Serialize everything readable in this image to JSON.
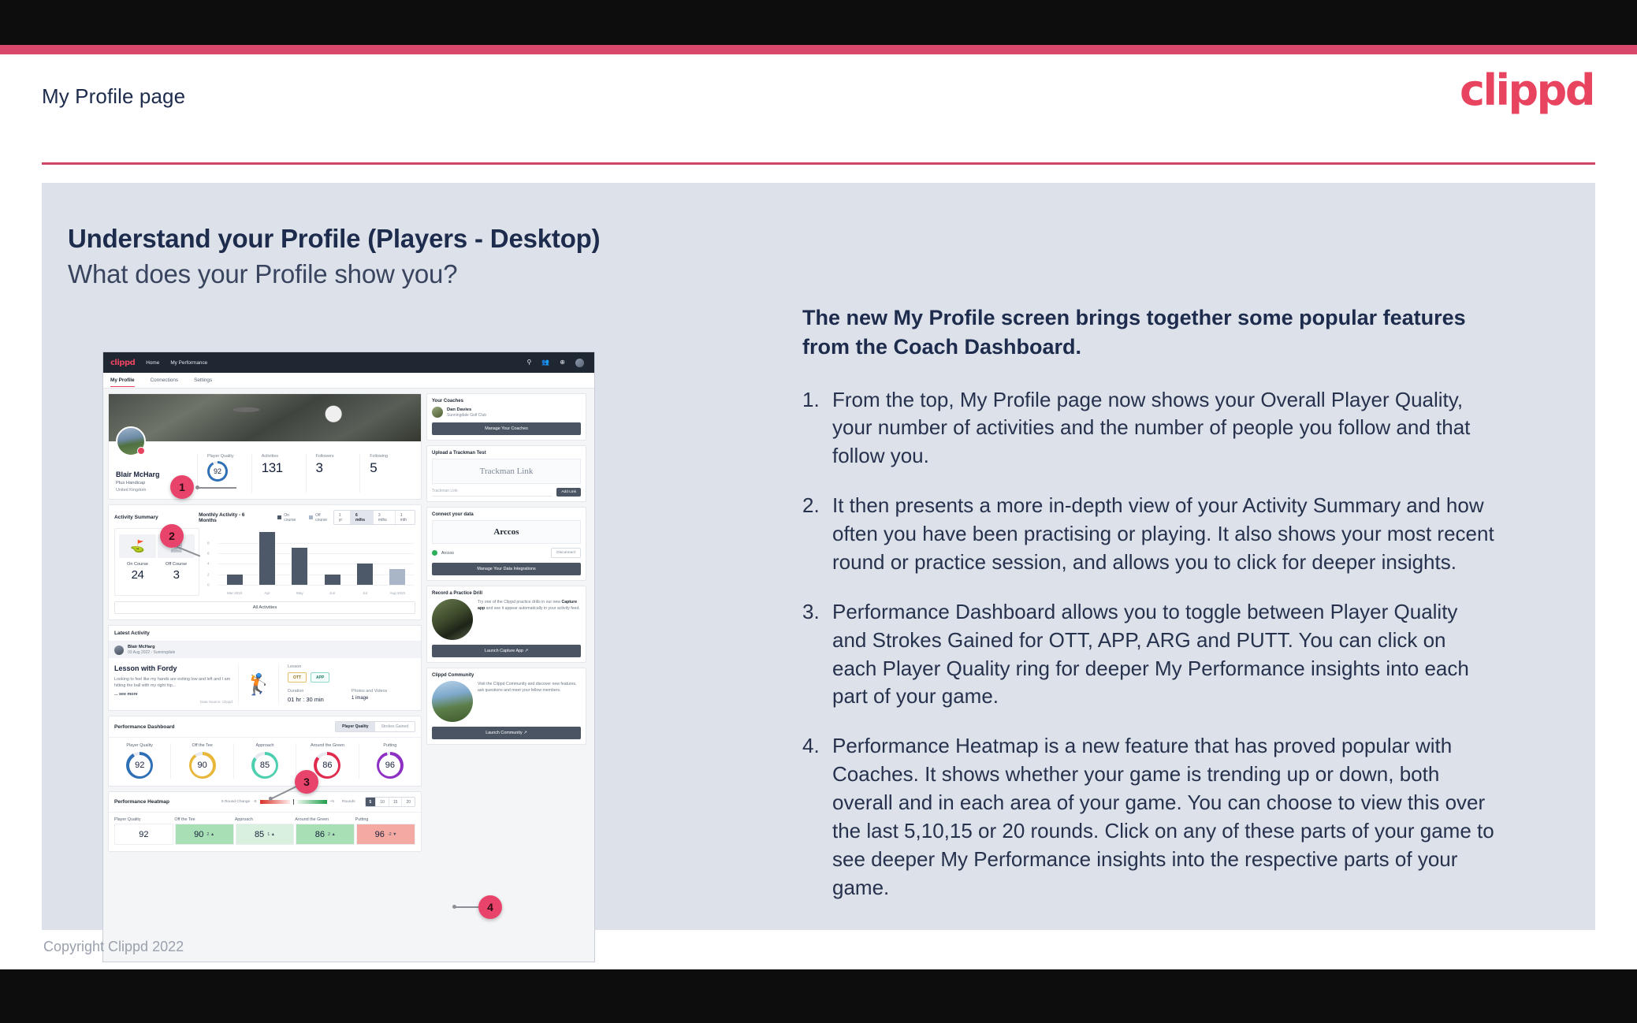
{
  "slide": {
    "header_title": "My Profile page",
    "brand": "clippd",
    "headline_main": "Understand your Profile (Players - Desktop)",
    "headline_sub": "What does your Profile show you?",
    "footer": "Copyright Clippd 2022"
  },
  "copy": {
    "lead": "The new My Profile screen brings together some popular features from the Coach Dashboard.",
    "items": [
      {
        "num": "1.",
        "text": "From the top, My Profile page now shows your Overall Player Quality, your number of activities and the number of people you follow and that follow you."
      },
      {
        "num": "2.",
        "text": "It then presents a more in-depth view of your Activity Summary and how often you have been practising or playing. It also shows your most recent round or practice session, and allows you to click for deeper insights."
      },
      {
        "num": "3.",
        "text": "Performance Dashboard allows you to toggle between Player Quality and Strokes Gained for OTT, APP, ARG and PUTT. You can click on each Player Quality ring for deeper My Performance insights into each part of your game."
      },
      {
        "num": "4.",
        "text": "Performance Heatmap is a new feature that has proved popular with Coaches. It shows whether your game is trending up or down, both overall and in each area of your game. You can choose to view this over the last 5,10,15 or 20 rounds. Click on any of these parts of your game to see deeper My Performance insights into the respective parts of your game."
      }
    ]
  },
  "callouts": [
    {
      "label": "1"
    },
    {
      "label": "2"
    },
    {
      "label": "3"
    },
    {
      "label": "4"
    }
  ],
  "app": {
    "nav": {
      "logo": "clippd",
      "links": [
        "Home",
        "My Performance"
      ],
      "icons": [
        "search-icon",
        "people-icon",
        "plus-circle-icon",
        "avatar"
      ]
    },
    "tabs": [
      {
        "label": "My Profile",
        "active": true
      },
      {
        "label": "Connections",
        "active": false
      },
      {
        "label": "Settings",
        "active": false
      }
    ],
    "profile": {
      "name": "Blair McHarg",
      "handicap": "Plus Handicap",
      "location": "United Kingdom",
      "stats": [
        {
          "label": "Player Quality",
          "value": "92",
          "type": "ring"
        },
        {
          "label": "Activities",
          "value": "131"
        },
        {
          "label": "Followers",
          "value": "3"
        },
        {
          "label": "Following",
          "value": "5"
        }
      ]
    },
    "activity": {
      "title": "Activity Summary",
      "chart_title": "Monthly Activity - 6 Months",
      "legend": [
        "On course",
        "Off course"
      ],
      "ranges": [
        {
          "label": "1 yr",
          "active": false
        },
        {
          "label": "6 mths",
          "active": true
        },
        {
          "label": "3 mths",
          "active": false
        },
        {
          "label": "1 mth",
          "active": false
        }
      ],
      "tiles": [
        {
          "label": "On Course",
          "value": "24",
          "icon": "golf-flag-icon"
        },
        {
          "label": "Off Course",
          "value": "3",
          "icon": "monitor-icon"
        }
      ],
      "all_button": "All Activities"
    },
    "latest": {
      "header": "Latest Activity",
      "user": "Blair McHarg",
      "date": "03 Aug 2022 - Sunningdale",
      "title": "Lesson with Fordy",
      "desc": "Looking to feel like my hands are exiting low and left and I am hitting the ball with my right hip...",
      "see_more": "... see more",
      "source": "Data Source: Clippd",
      "type_label": "Lesson",
      "chips": [
        "OTT",
        "APP"
      ],
      "duration_label": "Duration",
      "duration_value": "01 hr : 30 min",
      "media_label": "Photos and Videos",
      "media_value": "1 image"
    },
    "dashboard": {
      "title": "Performance Dashboard",
      "toggle": [
        {
          "label": "Player Quality",
          "active": true
        },
        {
          "label": "Strokes Gained",
          "active": false
        }
      ],
      "rings": [
        {
          "label": "Player Quality",
          "value": "92",
          "color": "#2f6fb5"
        },
        {
          "label": "Off the Tee",
          "value": "90",
          "color": "#e8b73a"
        },
        {
          "label": "Approach",
          "value": "85",
          "color": "#4ecfb0"
        },
        {
          "label": "Around the Green",
          "value": "86",
          "color": "#e02a4e"
        },
        {
          "label": "Putting",
          "value": "96",
          "color": "#8e30c4"
        }
      ]
    },
    "heatmap": {
      "title": "Performance Heatmap",
      "change_label": "5 Round Change",
      "scale_min": "-5",
      "scale_max": "+5",
      "rounds_label": "Rounds",
      "rounds": [
        {
          "label": "5",
          "active": true
        },
        {
          "label": "10",
          "active": false
        },
        {
          "label": "15",
          "active": false
        },
        {
          "label": "20",
          "active": false
        }
      ],
      "cells": [
        {
          "label": "Player Quality",
          "value": "92",
          "delta": "",
          "bg": "#ffffff"
        },
        {
          "label": "Off the Tee",
          "value": "90",
          "delta": "2 ▲",
          "bg": "#a8dfb4"
        },
        {
          "label": "Approach",
          "value": "85",
          "delta": "1 ▲",
          "bg": "#d9f0de"
        },
        {
          "label": "Around the Green",
          "value": "86",
          "delta": "2 ▲",
          "bg": "#a8dfb4"
        },
        {
          "label": "Putting",
          "value": "96",
          "delta": "-2 ▼",
          "bg": "#f4a9a2"
        }
      ]
    },
    "side": {
      "coaches": {
        "title": "Your Coaches",
        "coach_name": "Dan Davies",
        "coach_club": "Sunningdale Golf Club",
        "button": "Manage Your Coaches"
      },
      "trackman": {
        "title": "Upload a Trackman Test",
        "logo": "Trackman Link",
        "placeholder": "Trackman Link",
        "button": "Add Link"
      },
      "data": {
        "title": "Connect your data",
        "logo": "Arccos",
        "provider": "Arccos",
        "disconnect": "Disconnect",
        "button": "Manage Your Data Integrations"
      },
      "drill": {
        "title": "Record a Practice Drill",
        "text_1": "Try one of the Clippd practice drills in our new ",
        "text_bold": "Capture app",
        "text_2": " and see it appear automatically in your activity feed.",
        "button": "Launch Capture App"
      },
      "community": {
        "title": "Clippd Community",
        "text": "Visit the Clippd Community and discover new features, ask questions and meet your fellow members.",
        "button": "Launch Community"
      }
    }
  },
  "chart_data": {
    "type": "bar",
    "title": "Monthly Activity - 6 Months",
    "categories": [
      "Mar 2022",
      "Apr",
      "May",
      "Jun",
      "Jul",
      "Aug 2022"
    ],
    "values": [
      2,
      10,
      7,
      2,
      4,
      3
    ],
    "series": [
      {
        "name": "On course",
        "values": [
          2,
          10,
          7,
          2,
          4,
          null
        ],
        "color": "#4d5869"
      },
      {
        "name": "Off course",
        "values": [
          null,
          null,
          null,
          null,
          null,
          3
        ],
        "color": "#a8b6c8"
      }
    ],
    "yticks": [
      0,
      2,
      4,
      6,
      8
    ],
    "ylim": [
      0,
      10.5
    ],
    "xlabel": "",
    "ylabel": "",
    "grid": true,
    "legend": "top"
  }
}
